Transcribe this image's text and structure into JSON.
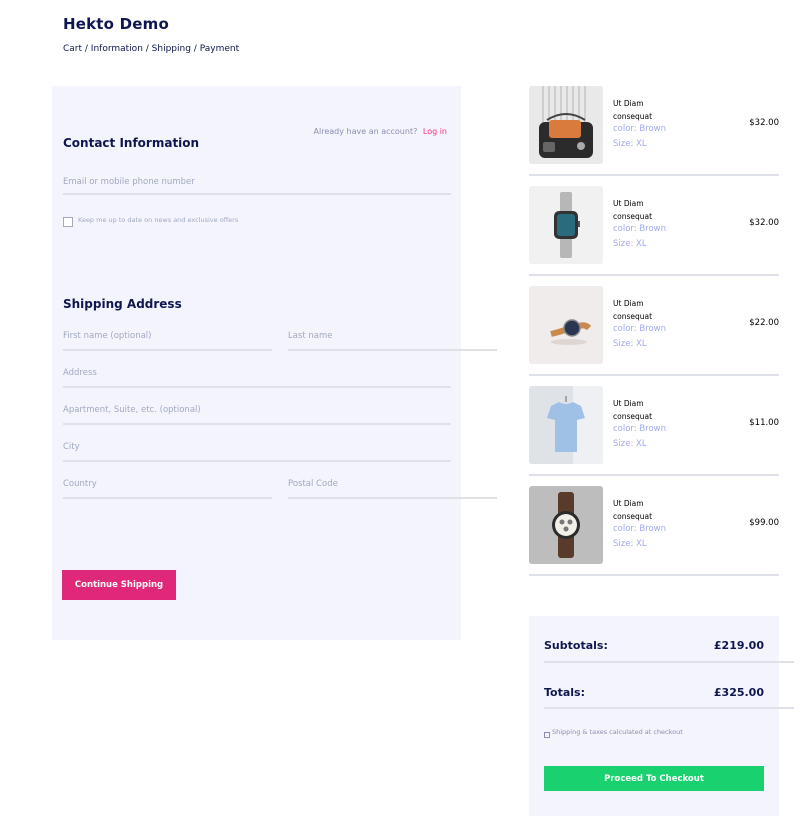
{
  "header": {
    "title": "Hekto Demo",
    "breadcrumb": [
      "Cart",
      "Information",
      "Shipping",
      "Payment"
    ],
    "separator": " / "
  },
  "contact": {
    "title": "Contact Information",
    "account_prompt": "Already have an account?",
    "login_label": "Log in",
    "email_placeholder": "Email or mobile phone number",
    "newsletter_label": "Keep me up to date on news and exclusive offers"
  },
  "shipping": {
    "title": "Shipping Address",
    "first_name_placeholder": "First name (optional)",
    "last_name_placeholder": "Last name",
    "address_placeholder": "Address",
    "apartment_placeholder": "Apartment, Suite, etc. (optional)",
    "city_placeholder": "City",
    "country_placeholder": "Country",
    "postal_code_placeholder": "Postal Code",
    "continue_label": "Continue Shipping"
  },
  "products": [
    {
      "name": "Ut Diam consequat",
      "color": "color: Brown",
      "size": "Size: XL",
      "price": "$32.00",
      "thumb": "bag"
    },
    {
      "name": "Ut Diam consequat",
      "color": "color: Brown",
      "size": "Size: XL",
      "price": "$32.00",
      "thumb": "smartwatch"
    },
    {
      "name": "Ut Diam consequat",
      "color": "color: Brown",
      "size": "Size: XL",
      "price": "$22.00",
      "thumb": "watch"
    },
    {
      "name": "Ut Diam consequat",
      "color": "color: Brown",
      "size": "Size: XL",
      "price": "$11.00",
      "thumb": "tshirt"
    },
    {
      "name": "Ut Diam consequat",
      "color": "color: Brown",
      "size": "Size: XL",
      "price": "$99.00",
      "thumb": "chronograph"
    }
  ],
  "totals": {
    "subtotal_label": "Subtotals:",
    "subtotal_value": "£219.00",
    "total_label": "Totals:",
    "total_value": "£325.00",
    "tax_note": "Shipping & taxes calculated at checkout",
    "checkout_label": "Proceed To Checkout"
  },
  "colors": {
    "navy": "#101750",
    "pink": "#fb2e86",
    "continue_button": "#e0287a",
    "checkout_button": "#19d16f",
    "panel_bg": "#f4f4fc",
    "muted_text": "#a1a8c1"
  }
}
